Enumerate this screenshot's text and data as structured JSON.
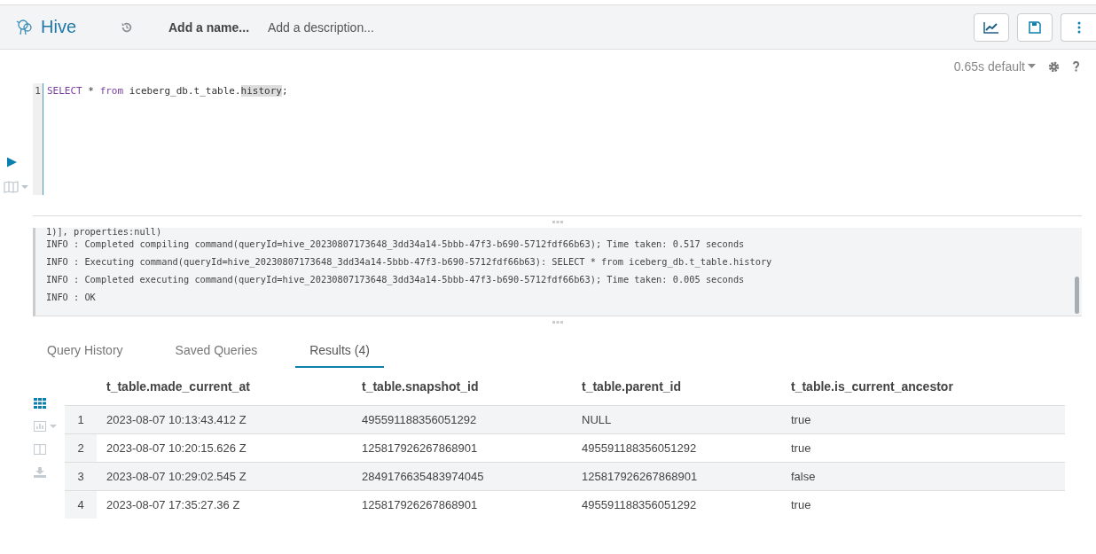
{
  "header": {
    "app_name": "Hive",
    "name_placeholder": "Add a name...",
    "description_placeholder": "Add a description..."
  },
  "toolbar": {
    "timing": "0.65s default"
  },
  "editor": {
    "line_numbers": [
      "1"
    ],
    "tokens": [
      {
        "text": "SELECT",
        "kind": "keyword",
        "highlighted": false
      },
      {
        "text": " * ",
        "kind": "plain",
        "highlighted": false
      },
      {
        "text": "from",
        "kind": "keyword",
        "highlighted": false
      },
      {
        "text": " iceberg_db.t_table.",
        "kind": "plain",
        "highlighted": false
      },
      {
        "text": "history",
        "kind": "plain",
        "highlighted": true
      },
      {
        "text": ";",
        "kind": "plain",
        "highlighted": false
      }
    ]
  },
  "log": [
    "1)], properties:null)",
    "INFO  : Completed compiling command(queryId=hive_20230807173648_3dd34a14-5bbb-47f3-b690-5712fdf66b63); Time taken: 0.517 seconds",
    "INFO  : Executing command(queryId=hive_20230807173648_3dd34a14-5bbb-47f3-b690-5712fdf66b63): SELECT * from iceberg_db.t_table.history",
    "INFO  : Completed executing command(queryId=hive_20230807173648_3dd34a14-5bbb-47f3-b690-5712fdf66b63); Time taken: 0.005 seconds",
    "INFO  : OK"
  ],
  "tabs": [
    {
      "label": "Query History",
      "selected": false
    },
    {
      "label": "Saved Queries",
      "selected": false
    },
    {
      "label": "Results (4)",
      "selected": true
    }
  ],
  "table": {
    "columns": [
      "",
      "t_table.made_current_at",
      "t_table.snapshot_id",
      "t_table.parent_id",
      "t_table.is_current_ancestor"
    ],
    "rows": [
      [
        "1",
        "2023-08-07 10:13:43.412 Z",
        "495591188356051292",
        "NULL",
        "true"
      ],
      [
        "2",
        "2023-08-07 10:20:15.626 Z",
        "125817926267868901",
        "495591188356051292",
        "true"
      ],
      [
        "3",
        "2023-08-07 10:29:02.545 Z",
        "2849176635483974045",
        "125817926267868901",
        "false"
      ],
      [
        "4",
        "2023-08-07 17:35:27.36 Z",
        "125817926267868901",
        "495591188356051292",
        "true"
      ]
    ]
  }
}
